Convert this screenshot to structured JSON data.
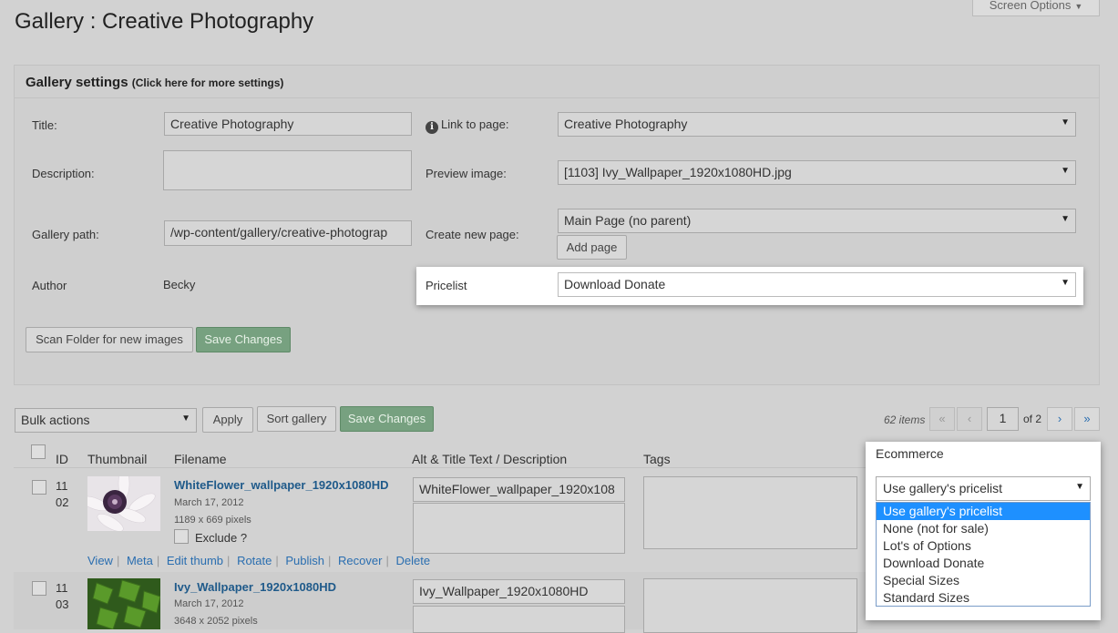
{
  "page": {
    "title": "Gallery : Creative Photography"
  },
  "screen_options": {
    "label": "Screen Options",
    "icon": "caret-down-icon"
  },
  "settings": {
    "header": "Gallery settings",
    "header_hint": "(Click here for more settings)",
    "title_label": "Title:",
    "title_value": "Creative Photography",
    "description_label": "Description:",
    "description_value": "",
    "path_label": "Gallery path:",
    "path_value": "/wp-content/gallery/creative-photograp",
    "author_label": "Author",
    "author_value": "Becky",
    "link_label": "Link to page:",
    "link_value": "Creative Photography",
    "preview_label": "Preview image:",
    "preview_value": "[1103] Ivy_Wallpaper_1920x1080HD.jpg",
    "newpage_label": "Create new page:",
    "newpage_value": "Main Page (no parent)",
    "add_page_button": "Add page",
    "pricelist_label": "Pricelist",
    "pricelist_value": "Download Donate",
    "scan_button": "Scan Folder for new images",
    "save_button": "Save Changes"
  },
  "toolbar": {
    "bulk_actions": "Bulk actions",
    "apply": "Apply",
    "sort": "Sort gallery",
    "save": "Save Changes",
    "item_count": "62 items",
    "first": "«",
    "prev": "‹",
    "current_page": "1",
    "of_pages": "of 2",
    "next": "›",
    "last": "»"
  },
  "table": {
    "columns": [
      "ID",
      "Thumbnail",
      "Filename",
      "Alt & Title Text / Description",
      "Tags",
      "Ecommerce"
    ],
    "rows": [
      {
        "id_line1": "11",
        "id_line2": "02",
        "filename": "WhiteFlower_wallpaper_1920x1080HD",
        "date": "March 17, 2012",
        "dims": "1189 x 669 pixels",
        "exclude": "Exclude ?",
        "alt": "WhiteFlower_wallpaper_1920x108",
        "actions": [
          "View",
          "Meta",
          "Edit thumb",
          "Rotate",
          "Publish",
          "Recover",
          "Delete"
        ]
      },
      {
        "id_line1": "11",
        "id_line2": "03",
        "filename": "Ivy_Wallpaper_1920x1080HD",
        "date": "March 17, 2012",
        "dims": "3648 x 2052 pixels",
        "alt": "Ivy_Wallpaper_1920x1080HD"
      }
    ]
  },
  "ecommerce": {
    "header": "Ecommerce",
    "selected": "Use gallery's pricelist",
    "options": [
      "Use gallery's pricelist",
      "None (not for sale)",
      "Lot's of Options",
      "Download Donate",
      "Special Sizes",
      "Standard Sizes"
    ],
    "highlighted_index": 0
  },
  "colors": {
    "background": "#d2d2d2",
    "link": "#2a6eb0",
    "green_button": "#77a180",
    "dropdown_highlight": "#1e90ff"
  }
}
